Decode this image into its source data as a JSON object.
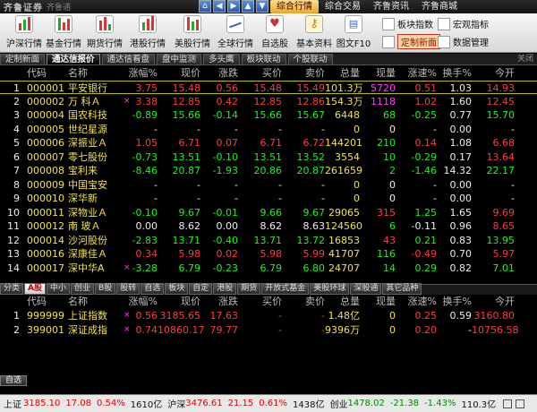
{
  "titlebar": {
    "logo": "齐鲁证券",
    "logo_sub": "齐鲁通",
    "menus": [
      "综合行情",
      "综合交易",
      "齐鲁资讯",
      "齐鲁商城"
    ]
  },
  "toolbar": {
    "tools": [
      {
        "label": "沪深行情",
        "icon": "market-bars-icon"
      },
      {
        "label": "基金行情",
        "icon": "fund-bars-icon"
      },
      {
        "label": "期货行情",
        "icon": "futures-bars-icon"
      },
      {
        "label": "港股行情",
        "icon": "hk-bars-icon"
      },
      {
        "label": "美股行情",
        "icon": "us-bars-icon"
      },
      {
        "label": "全球行情",
        "icon": "global-chart-icon"
      },
      {
        "label": "自选股",
        "icon": "favorites-icon"
      },
      {
        "label": "基本资料",
        "icon": "key-icon"
      },
      {
        "label": "图文F10",
        "icon": "f10-icon"
      }
    ],
    "right": {
      "sector_index": "板块指数",
      "macro_index": "宏观指标",
      "custom_page": "定制新面",
      "data_mgmt": "数据管理"
    }
  },
  "tabs1": {
    "items": [
      "定制新面",
      "通达信报价",
      "通达信看盘",
      "盘中监测",
      "多头鹰",
      "板块联动",
      "个股联动"
    ],
    "active_index": 1,
    "close_label": "关闭"
  },
  "columns": [
    "代码",
    "名称",
    "涨幅%",
    "现价",
    "涨跌",
    "买价",
    "卖价",
    "总量",
    "现量",
    "涨速%",
    "换手%",
    "今开"
  ],
  "stocks": [
    {
      "idx": "1",
      "code": "000001",
      "name": "平安银行",
      "mark": "",
      "pct": "3.75",
      "price": "15.48",
      "chg": "0.56",
      "bid": "15.48",
      "ask": "15.49",
      "vol": "101.3万",
      "cur": "5720",
      "spd": "0.51",
      "turn": "1.03",
      "open": "14.93",
      "dir": "up",
      "cur_dir": "mag",
      "open_dir": "up"
    },
    {
      "idx": "2",
      "code": "000002",
      "name": "万 科Ａ",
      "mark": "×",
      "pct": "3.38",
      "price": "12.85",
      "chg": "0.42",
      "bid": "12.85",
      "ask": "12.86",
      "vol": "154.3万",
      "cur": "1118",
      "spd": "1.02",
      "turn": "1.60",
      "open": "12.45",
      "dir": "up",
      "cur_dir": "mag",
      "open_dir": "up"
    },
    {
      "idx": "3",
      "code": "000004",
      "name": "国农科技",
      "mark": "",
      "pct": "-0.89",
      "price": "15.66",
      "chg": "-0.14",
      "bid": "15.66",
      "ask": "15.67",
      "vol": "6448",
      "cur": "68",
      "spd": "-0.25",
      "turn": "0.77",
      "open": "15.70",
      "dir": "dn",
      "cur_dir": "dn",
      "open_dir": "dn"
    },
    {
      "idx": "4",
      "code": "000005",
      "name": "世纪星源",
      "mark": "",
      "pct": "-",
      "price": "-",
      "chg": "-",
      "bid": "-",
      "ask": "-",
      "vol": "0",
      "cur": "0",
      "spd": "-",
      "turn": "0.00",
      "open": "-",
      "dir": "eq",
      "cur_dir": "eq",
      "open_dir": "eq"
    },
    {
      "idx": "5",
      "code": "000006",
      "name": "深振业Ａ",
      "mark": "",
      "pct": "1.05",
      "price": "6.71",
      "chg": "0.07",
      "bid": "6.71",
      "ask": "6.72",
      "vol": "144201",
      "cur": "210",
      "spd": "0.14",
      "turn": "1.08",
      "open": "6.68",
      "dir": "up",
      "cur_dir": "dn",
      "open_dir": "up"
    },
    {
      "idx": "6",
      "code": "000007",
      "name": "零七股份",
      "mark": "",
      "pct": "-0.73",
      "price": "13.51",
      "chg": "-0.10",
      "bid": "13.51",
      "ask": "13.52",
      "vol": "3554",
      "cur": "10",
      "spd": "-0.29",
      "turn": "0.17",
      "open": "13.64",
      "dir": "dn",
      "cur_dir": "dn",
      "open_dir": "up"
    },
    {
      "idx": "7",
      "code": "000008",
      "name": "宝利来",
      "mark": "",
      "pct": "-8.46",
      "price": "20.87",
      "chg": "-1.93",
      "bid": "20.86",
      "ask": "20.87",
      "vol": "261659",
      "cur": "2",
      "spd": "-1.46",
      "turn": "14.32",
      "open": "22.17",
      "dir": "dn",
      "cur_dir": "dn",
      "open_dir": "dn"
    },
    {
      "idx": "8",
      "code": "000009",
      "name": "中国宝安",
      "mark": "",
      "pct": "-",
      "price": "-",
      "chg": "-",
      "bid": "-",
      "ask": "-",
      "vol": "0",
      "cur": "0",
      "spd": "-",
      "turn": "0.00",
      "open": "-",
      "dir": "eq",
      "cur_dir": "eq",
      "open_dir": "eq"
    },
    {
      "idx": "9",
      "code": "000010",
      "name": "深华新",
      "mark": "",
      "pct": "-",
      "price": "-",
      "chg": "-",
      "bid": "-",
      "ask": "-",
      "vol": "0",
      "cur": "0",
      "spd": "-",
      "turn": "0.00",
      "open": "-",
      "dir": "eq",
      "cur_dir": "eq",
      "open_dir": "eq"
    },
    {
      "idx": "10",
      "code": "000011",
      "name": "深物业Ａ",
      "mark": "",
      "pct": "-0.10",
      "price": "9.67",
      "chg": "-0.01",
      "bid": "9.66",
      "ask": "9.67",
      "vol": "29065",
      "cur": "315",
      "spd": "1.25",
      "turn": "1.65",
      "open": "9.69",
      "dir": "dn",
      "cur_dir": "up",
      "open_dir": "up"
    },
    {
      "idx": "11",
      "code": "000012",
      "name": "南 玻Ａ",
      "mark": "",
      "pct": "0.00",
      "price": "8.62",
      "chg": "0.00",
      "bid": "8.62",
      "ask": "8.63",
      "vol": "124560",
      "cur": "6",
      "spd": "-0.11",
      "turn": "0.96",
      "open": "8.65",
      "dir": "eq",
      "cur_dir": "dn",
      "open_dir": "up"
    },
    {
      "idx": "12",
      "code": "000014",
      "name": "沙河股份",
      "mark": "",
      "pct": "-2.83",
      "price": "13.71",
      "chg": "-0.40",
      "bid": "13.71",
      "ask": "13.72",
      "vol": "16853",
      "cur": "43",
      "spd": "0.21",
      "turn": "0.83",
      "open": "13.95",
      "dir": "dn",
      "cur_dir": "up",
      "open_dir": "dn"
    },
    {
      "idx": "13",
      "code": "000016",
      "name": "深康佳Ａ",
      "mark": "",
      "pct": "0.34",
      "price": "5.98",
      "chg": "0.02",
      "bid": "5.98",
      "ask": "5.99",
      "vol": "41707",
      "cur": "116",
      "spd": "-0.49",
      "turn": "0.70",
      "open": "5.97",
      "dir": "up",
      "cur_dir": "dn",
      "open_dir": "up"
    },
    {
      "idx": "14",
      "code": "000017",
      "name": "深中华A",
      "mark": "×",
      "pct": "-3.28",
      "price": "6.79",
      "chg": "-0.23",
      "bid": "6.79",
      "ask": "6.80",
      "vol": "24707",
      "cur": "14",
      "spd": "0.29",
      "turn": "0.82",
      "open": "7.01",
      "dir": "dn",
      "cur_dir": "dn",
      "open_dir": "dn"
    }
  ],
  "tabs2": [
    "分类",
    "A股",
    "中小",
    "创业",
    "B股",
    "股转",
    "自选",
    "板块",
    "自定",
    "港股",
    "期货",
    "开放式基金",
    "美股环球",
    "深股通",
    "其它品种"
  ],
  "tabs2_active": 1,
  "indices": [
    {
      "idx": "1",
      "code": "999999",
      "name": "上证指数",
      "mark": "×",
      "pct": "0.56",
      "price": "3185.65",
      "chg": "17.63",
      "bid": "-",
      "ask": "-",
      "vol": "1.48亿",
      "cur": "0",
      "spd": "0.25",
      "turn": "0.59",
      "open": "3160.80",
      "dir": "up"
    },
    {
      "idx": "2",
      "code": "399001",
      "name": "深证成指",
      "mark": "×",
      "pct": "0.74",
      "price": "10860.17",
      "chg": "79.77",
      "bid": "-",
      "ask": "-",
      "vol": "9396万",
      "cur": "0",
      "spd": "0.20",
      "turn": "-",
      "open": "10756.58",
      "dir": "up"
    }
  ],
  "bottom": {
    "self_tab": "自选"
  },
  "status": {
    "sh_label": "上证",
    "sh_value": "3185.10",
    "sh_chg": "17.08",
    "sh_pct": "0.54%",
    "sh_amt": "1610亿",
    "hs_label": "沪深",
    "hs_value": "3476.61",
    "hs_chg": "21.15",
    "hs_pct": "0.61%",
    "hs_amt": "1438亿",
    "cy_label": "创业",
    "cy_value": "1478.02",
    "cy_chg": "-21.38",
    "cy_pct": "-1.43%",
    "cy_amt": "110.3亿"
  },
  "colors": {
    "up": "#ff3c3c",
    "down": "#20f020",
    "highlight": "#f2e24a",
    "background": "#000000"
  }
}
